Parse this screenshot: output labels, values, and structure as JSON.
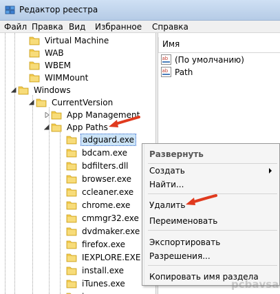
{
  "window": {
    "title": "Редактор реестра"
  },
  "menu": [
    "Файл",
    "Правка",
    "Вид",
    "Избранное",
    "Справка"
  ],
  "tree": {
    "nodes": [
      {
        "label": "Virtual Machine",
        "expanded": false,
        "selected": false
      },
      {
        "label": "WAB",
        "expanded": false,
        "selected": false
      },
      {
        "label": "WBEM",
        "expanded": false,
        "selected": false
      },
      {
        "label": "WIMMount",
        "expanded": false,
        "selected": false
      },
      {
        "label": "Windows",
        "expanded": true,
        "selected": false
      },
      {
        "label": "CurrentVersion",
        "expanded": true,
        "selected": false
      },
      {
        "label": "App Management",
        "expanded": false,
        "selected": false
      },
      {
        "label": "App Paths",
        "expanded": true,
        "selected": false
      },
      {
        "label": "adguard.exe",
        "expanded": false,
        "selected": true
      },
      {
        "label": "bdcam.exe",
        "expanded": false,
        "selected": false
      },
      {
        "label": "bdfilters.dll",
        "expanded": false,
        "selected": false
      },
      {
        "label": "browser.exe",
        "expanded": false,
        "selected": false
      },
      {
        "label": "ccleaner.exe",
        "expanded": false,
        "selected": false
      },
      {
        "label": "chrome.exe",
        "expanded": false,
        "selected": false
      },
      {
        "label": "cmmgr32.exe",
        "expanded": false,
        "selected": false
      },
      {
        "label": "dvdmaker.exe",
        "expanded": false,
        "selected": false
      },
      {
        "label": "firefox.exe",
        "expanded": false,
        "selected": false
      },
      {
        "label": "IEXPLORE.EXE",
        "expanded": false,
        "selected": false
      },
      {
        "label": "install.exe",
        "expanded": false,
        "selected": false
      },
      {
        "label": "iTunes.exe",
        "expanded": false,
        "selected": false
      },
      {
        "label": "javaws.exe",
        "expanded": false,
        "selected": false
      }
    ]
  },
  "values_pane": {
    "column_header": "Имя",
    "rows": [
      {
        "name": "(По умолчанию)",
        "icon": "string-value-icon"
      },
      {
        "name": "Path",
        "icon": "string-value-icon"
      }
    ]
  },
  "context_menu": {
    "expand": "Развернуть",
    "create": "Создать",
    "find": "Найти...",
    "delete": "Удалить",
    "rename": "Переименовать",
    "export": "Экспортировать",
    "permissions": "Разрешения...",
    "copy_key_name": "Копировать имя раздела"
  },
  "watermark": "pcbavsa.ru",
  "colors": {
    "annotation_arrow": "#e03a1e",
    "folder": "#f2c94c",
    "selection": "#cce4f7"
  }
}
